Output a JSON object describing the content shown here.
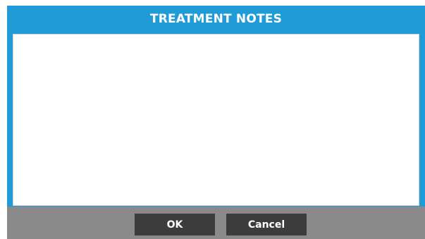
{
  "dialog": {
    "title": "TREATMENT NOTES",
    "notes": {
      "value": "",
      "placeholder": ""
    },
    "buttons": {
      "ok_label": "OK",
      "cancel_label": "Cancel"
    }
  },
  "colors": {
    "title_bar": "#1f9bd8",
    "button_bar": "#8a8a8a",
    "button_bg": "#3c3c3c",
    "text_light": "#ffffff"
  }
}
